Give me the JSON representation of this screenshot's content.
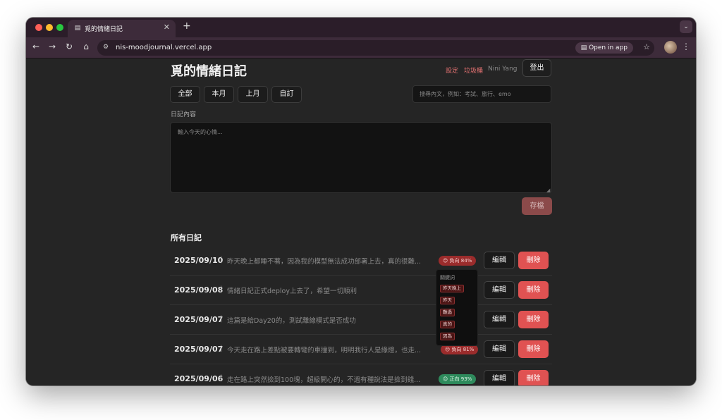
{
  "browser": {
    "tab_title": "覓的情緒日記",
    "tab_icon": "book-icon",
    "url": "nis-moodjournal.vercel.app",
    "open_in_app": "Open in app"
  },
  "header": {
    "title": "覓的情緒日記",
    "settings": "設定",
    "trash": "垃圾桶",
    "user": "Nini Yang",
    "logout": "登出"
  },
  "filters": [
    "全部",
    "本月",
    "上月",
    "自訂"
  ],
  "search": {
    "placeholder": "搜尋內文，例如：考試、旅行、emo"
  },
  "editor": {
    "label": "日記內容",
    "placeholder": "輸入今天的心情...",
    "save": "存檔"
  },
  "list": {
    "title": "所有日記",
    "edit_label": "編輯",
    "delete_label": "刪除",
    "entries": [
      {
        "date": "2025/09/10",
        "sep": "|",
        "text": "昨天晚上都睡不著，因為我的模型無法成功部署上去，真的很難...",
        "badge": "😔 負向 84%",
        "sentiment": "negative"
      },
      {
        "date": "2025/09/08",
        "sep": "|",
        "text": "情緒日記正式deploy上去了，希望一切順利",
        "badge": "",
        "sentiment": ""
      },
      {
        "date": "2025/09/07",
        "sep": "|",
        "text": "這篇是給Day20的，測試離線模式是否成功",
        "badge": "",
        "sentiment": ""
      },
      {
        "date": "2025/09/07",
        "sep": "|",
        "text": "今天走在路上差點被要轉彎的車撞到，明明我行人是綠燈，也走...",
        "badge": "😔 負向 81%",
        "sentiment": "negative"
      },
      {
        "date": "2025/09/06",
        "sep": "|",
        "text": "走在路上突然撿到100塊，超級開心的，不過有種說法是撿到錢...",
        "badge": "😊 正向 93%",
        "sentiment": "positive"
      }
    ]
  },
  "keywords_popover": {
    "title": "關鍵詞",
    "chips": [
      "昨天晚上",
      "昨天",
      "難過",
      "真的",
      "因為"
    ]
  },
  "colors": {
    "background": "#252525",
    "accent_red": "#e05252",
    "negative_badge": "#9b2c2c",
    "positive_badge": "#2e8a5c",
    "link_red": "#e07070"
  }
}
